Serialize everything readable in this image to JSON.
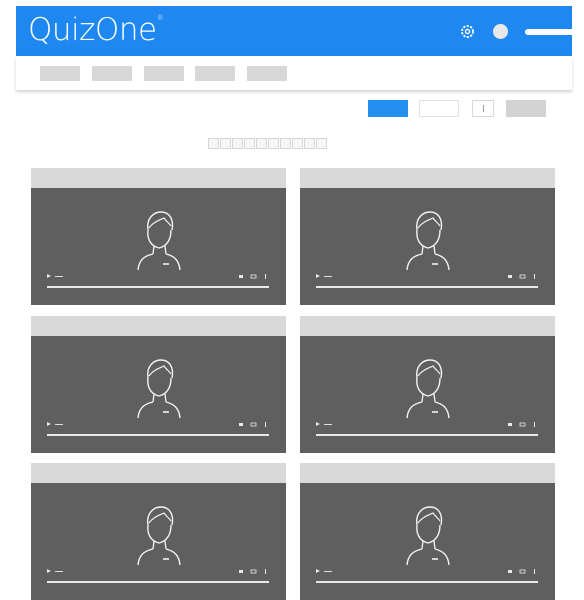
{
  "app": {
    "logo_text": "QuizOne",
    "logo_mark": "®",
    "brand_color": "#1e88f0"
  },
  "header_icons": [
    "gear-icon",
    "avatar",
    "hamburger-bar-icon"
  ],
  "subnav_tabs": [
    {
      "name": "nav-tab-1"
    },
    {
      "name": "nav-tab-2"
    },
    {
      "name": "nav-tab-3"
    },
    {
      "name": "nav-tab-4"
    },
    {
      "name": "nav-tab-5"
    }
  ],
  "toolbar": {
    "controls": [
      "primary-button",
      "outline-button",
      "small-toggle",
      "gray-button"
    ]
  },
  "pagination": {
    "page_count": 10
  },
  "video_cards": [
    {
      "name": "video-card-1",
      "thumbnail": "person-outline-icon"
    },
    {
      "name": "video-card-2",
      "thumbnail": "person-outline-icon"
    },
    {
      "name": "video-card-3",
      "thumbnail": "person-outline-icon"
    },
    {
      "name": "video-card-4",
      "thumbnail": "person-outline-icon"
    },
    {
      "name": "video-card-5",
      "thumbnail": "person-outline-icon"
    },
    {
      "name": "video-card-6",
      "thumbnail": "person-outline-icon"
    }
  ]
}
